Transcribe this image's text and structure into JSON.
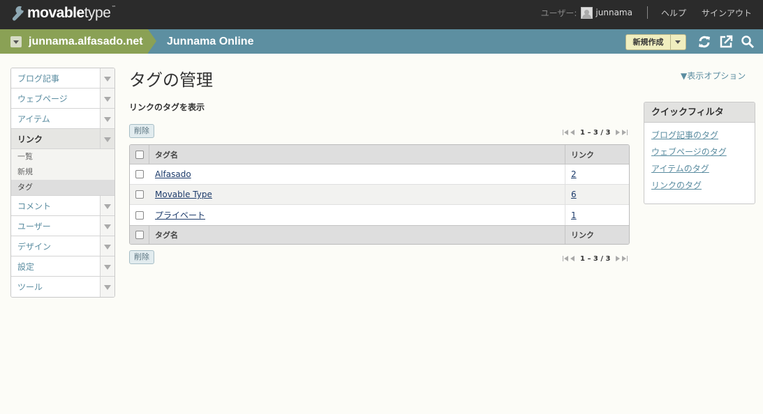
{
  "app": {
    "logo_bold": "movable",
    "logo_light": "type",
    "logo_tm": "™"
  },
  "user": {
    "label": "ユーザー:",
    "name": "junnama",
    "help": "ヘルプ",
    "signout": "サインアウト"
  },
  "blogbar": {
    "site": "junnama.alfasado.net",
    "blog": "Junnama Online",
    "new_button": "新規作成"
  },
  "sidebar": {
    "items": [
      {
        "label": "ブログ記事"
      },
      {
        "label": "ウェブページ"
      },
      {
        "label": "アイテム"
      },
      {
        "label": "リンク"
      },
      {
        "label": "コメント"
      },
      {
        "label": "ユーザー"
      },
      {
        "label": "デザイン"
      },
      {
        "label": "設定"
      },
      {
        "label": "ツール"
      }
    ],
    "submenu": [
      {
        "label": "一覧"
      },
      {
        "label": "新規"
      },
      {
        "label": "タグ"
      }
    ]
  },
  "main": {
    "title": "タグの管理",
    "display_options": "▼表示オプション",
    "subtitle": "リンクのタグを表示",
    "delete_label": "削除",
    "pager_text": "1 – 3 / 3"
  },
  "table": {
    "col_name": "タグ名",
    "col_count": "リンク",
    "rows": [
      {
        "name": "Alfasado",
        "count": "2"
      },
      {
        "name": "Movable Type",
        "count": "6"
      },
      {
        "name": "プライベート",
        "count": "1"
      }
    ]
  },
  "quick_filter": {
    "title": "クイックフィルタ",
    "items": [
      {
        "label": "ブログ記事のタグ"
      },
      {
        "label": "ウェブページのタグ"
      },
      {
        "label": "アイテムのタグ"
      },
      {
        "label": "リンクのタグ"
      }
    ]
  },
  "colors": {
    "topbar": "#2b2b2b",
    "blogbar": "#5d8fa1",
    "site_tab": "#8aa155",
    "link": "#5a8ca0"
  }
}
